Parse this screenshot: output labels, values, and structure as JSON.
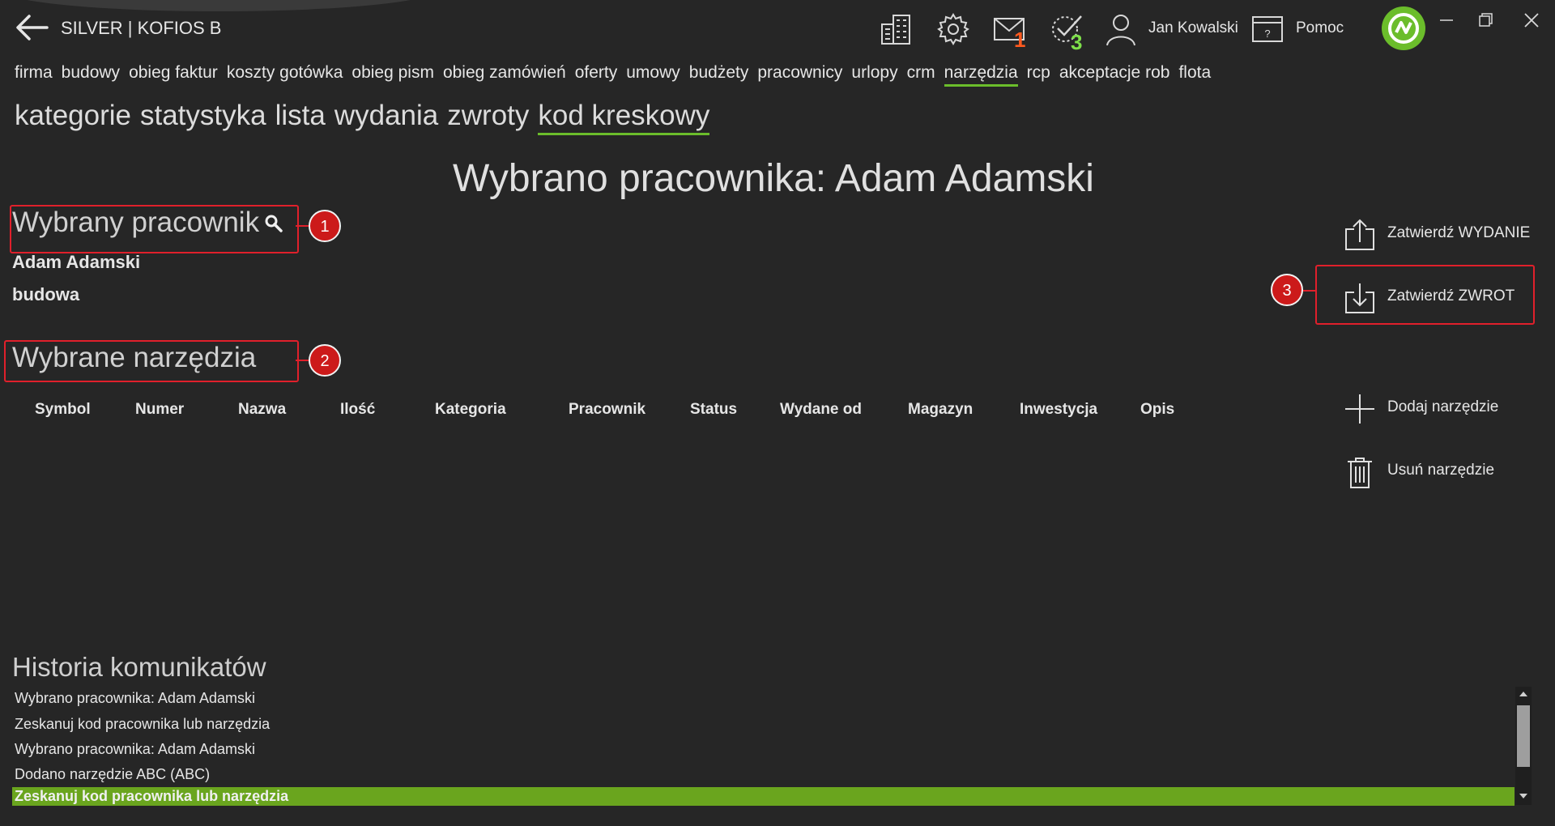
{
  "app": {
    "title": "SILVER | KOFIOS B"
  },
  "topbar": {
    "mail_count": "1",
    "tasks_count": "3",
    "user_name": "Jan Kowalski",
    "help_label": "Pomoc",
    "colors": {
      "mail_badge": "#ff5a1f",
      "tasks_badge": "#7ee04a",
      "accent": "#6bbd2b"
    }
  },
  "main_nav": {
    "items": [
      "firma",
      "budowy",
      "obieg faktur",
      "koszty gotówka",
      "obieg pism",
      "obieg zamówień",
      "oferty",
      "umowy",
      "budżety",
      "pracownicy",
      "urlopy",
      "crm",
      "narzędzia",
      "rcp",
      "akceptacje rob",
      "flota"
    ],
    "active": "narzędzia"
  },
  "sub_nav": {
    "items": [
      "kategorie",
      "statystyka",
      "lista",
      "wydania",
      "zwroty",
      "kod kreskowy"
    ],
    "active": "kod kreskowy"
  },
  "main": {
    "heading": "Wybrano pracownika: Adam Adamski",
    "employee_section_title": "Wybrany pracownik",
    "employee_name": "Adam Adamski",
    "employee_site": "budowa",
    "tools_section_title": "Wybrane narzędzia",
    "columns": [
      "Symbol",
      "Numer",
      "Nazwa",
      "Ilość",
      "Kategoria",
      "Pracownik",
      "Status",
      "Wydane od",
      "Magazyn",
      "Inwestycja",
      "Opis"
    ]
  },
  "actions": {
    "confirm_issue": "Zatwierdź WYDANIE",
    "confirm_return": "Zatwierdź ZWROT",
    "add_tool": "Dodaj narzędzie",
    "remove_tool": "Usuń narzędzie"
  },
  "callouts": [
    "1",
    "2",
    "3"
  ],
  "history": {
    "title": "Historia komunikatów",
    "items": [
      "Wybrano pracownika: Adam Adamski",
      "Zeskanuj kod pracownika lub narzędzia",
      "Wybrano pracownika: Adam Adamski",
      "Dodano narzędzie ABC (ABC)",
      "Zeskanuj kod pracownika lub narzędzia"
    ],
    "highlight_color": "#6aa51e"
  }
}
